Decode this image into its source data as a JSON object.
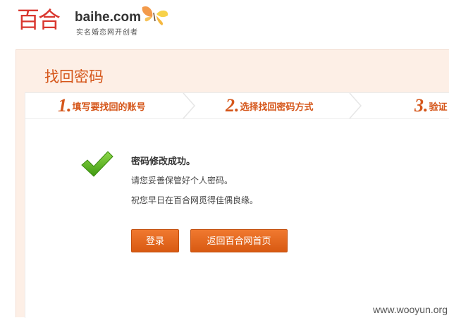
{
  "logo": {
    "cn": "百合",
    "domain": "baihe.com",
    "tagline": "实名婚恋网开创者",
    "icon": "butterfly-icon"
  },
  "page": {
    "title": "找回密码"
  },
  "steps": [
    {
      "number": "1.",
      "label": "填写要找回的账号"
    },
    {
      "number": "2.",
      "label": "选择找回密码方式"
    },
    {
      "number": "3.",
      "label": "验证"
    }
  ],
  "result": {
    "icon": "checkmark-icon",
    "title": "密码修改成功。",
    "line1": "请您妥善保管好个人密码。",
    "line2": "祝您早日在百合网觅得佳偶良缘。"
  },
  "buttons": {
    "login": "登录",
    "home": "返回百合网首页"
  },
  "watermark": "www.wooyun.org",
  "colors": {
    "accent": "#d5561a",
    "button": "#e76a22",
    "panel_bg": "#fdefe6",
    "check": "#5fb820"
  }
}
